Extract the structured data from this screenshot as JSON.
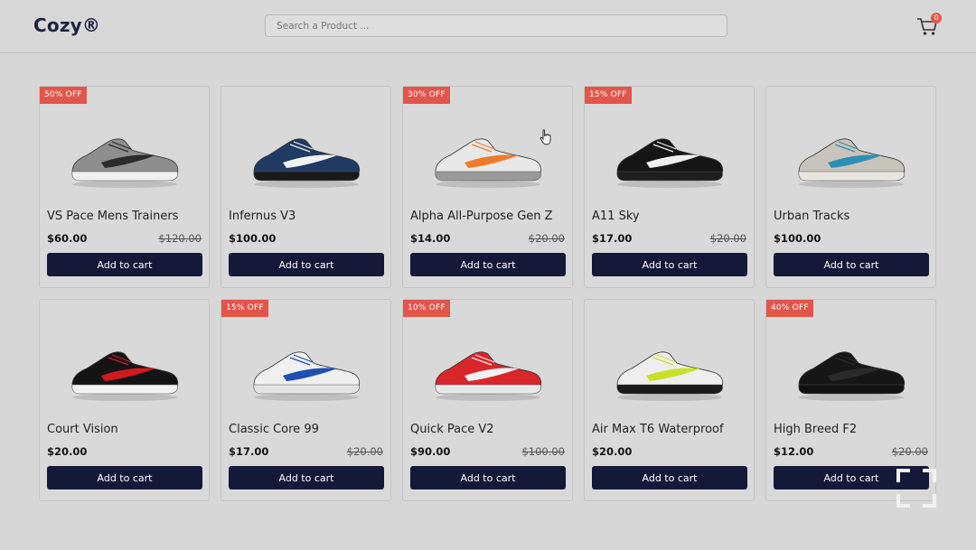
{
  "header": {
    "logo": "Cozy®",
    "search_placeholder": "Search a Product ...",
    "cart_count": "0"
  },
  "products": [
    {
      "name": "VS Pace Mens Trainers",
      "price": "$60.00",
      "old_price": "$120.00",
      "badge": "50% OFF",
      "button": "Add to cart",
      "colors": {
        "upper": "#8e8e8e",
        "accent": "#2b2b2b",
        "sole": "#f0f0f0"
      }
    },
    {
      "name": "Infernus V3",
      "price": "$100.00",
      "old_price": "",
      "badge": "",
      "button": "Add to cart",
      "colors": {
        "upper": "#1f3a63",
        "accent": "#f2f2f2",
        "sole": "#1a1a1a"
      }
    },
    {
      "name": "Alpha All-Purpose Gen Z",
      "price": "$14.00",
      "old_price": "$20.00",
      "badge": "30% OFF",
      "button": "Add to cart",
      "colors": {
        "upper": "#e8e8e8",
        "accent": "#f07b2c",
        "sole": "#9a9a9a"
      }
    },
    {
      "name": "A11 Sky",
      "price": "$17.00",
      "old_price": "$20.00",
      "badge": "15% OFF",
      "button": "Add to cart",
      "colors": {
        "upper": "#151515",
        "accent": "#f0f0f0",
        "sole": "#1e1e1e"
      }
    },
    {
      "name": "Urban Tracks",
      "price": "$100.00",
      "old_price": "",
      "badge": "",
      "button": "Add to cart",
      "colors": {
        "upper": "#c9c4bb",
        "accent": "#2e8fb5",
        "sole": "#e8e6e0"
      }
    },
    {
      "name": "Court Vision",
      "price": "$20.00",
      "old_price": "",
      "badge": "",
      "button": "Add to cart",
      "colors": {
        "upper": "#141414",
        "accent": "#d11a1f",
        "sole": "#f2f2f2"
      }
    },
    {
      "name": "Classic Core 99",
      "price": "$17.00",
      "old_price": "$20.00",
      "badge": "15% OFF",
      "button": "Add to cart",
      "colors": {
        "upper": "#f0f0f0",
        "accent": "#1f4fb3",
        "sole": "#e3e3e3"
      }
    },
    {
      "name": "Quick Pace V2",
      "price": "$90.00",
      "old_price": "$100.00",
      "badge": "10% OFF",
      "button": "Add to cart",
      "colors": {
        "upper": "#d9262a",
        "accent": "#f2f2f2",
        "sole": "#e8e8e8"
      }
    },
    {
      "name": "Air Max T6 Waterproof",
      "price": "$20.00",
      "old_price": "",
      "badge": "",
      "button": "Add to cart",
      "colors": {
        "upper": "#eeeeee",
        "accent": "#c8e02c",
        "sole": "#1a1a1a"
      }
    },
    {
      "name": "High Breed F2",
      "price": "$12.00",
      "old_price": "$20.00",
      "badge": "40% OFF",
      "button": "Add to cart",
      "colors": {
        "upper": "#161616",
        "accent": "#2a2a2a",
        "sole": "#121212"
      }
    }
  ]
}
